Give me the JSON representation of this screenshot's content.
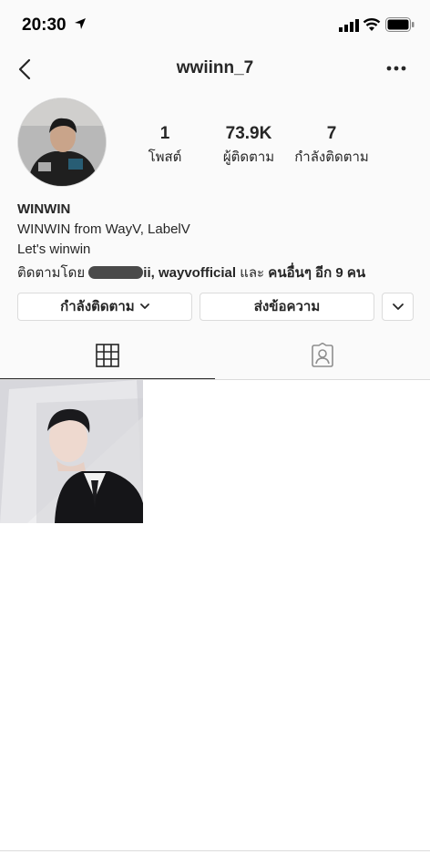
{
  "status_bar": {
    "time": "20:30",
    "icons": [
      "location-arrow-icon",
      "signal-icon",
      "wifi-icon",
      "battery-icon"
    ]
  },
  "nav": {
    "title": "wwiinn_7",
    "back_icon": "chevron-left-icon",
    "more_icon": "more-horizontal-icon"
  },
  "profile": {
    "stats": [
      {
        "value": "1",
        "label": "โพสต์"
      },
      {
        "value": "73.9K",
        "label": "ผู้ติดตาม"
      },
      {
        "value": "7",
        "label": "กำลังติดตาม"
      }
    ],
    "name": "WINWIN",
    "bio": [
      "WINWIN from WayV, LabelV",
      "Let's winwin"
    ],
    "followed_by": {
      "prefix": "ติดตามโดย",
      "names": "ii, wayvofficial",
      "connector": "และ",
      "others": "คนอื่นๆ อีก 9 คน"
    }
  },
  "actions": {
    "following_label": "กำลังติดตาม",
    "message_label": "ส่งข้อความ"
  },
  "tabs": [
    {
      "icon": "grid-icon",
      "active": true
    },
    {
      "icon": "tagged-person-icon",
      "active": false
    }
  ],
  "colors": {
    "text": "#262626",
    "border": "#dbdbdb",
    "header_bg": "#fafafa"
  }
}
